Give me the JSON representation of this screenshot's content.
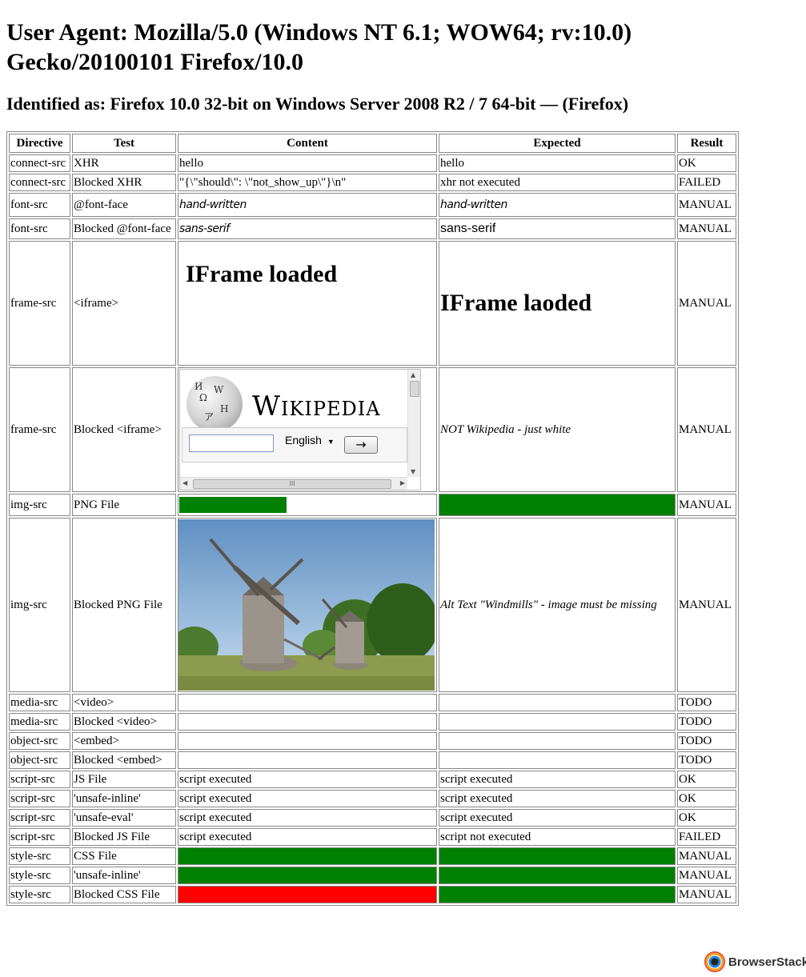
{
  "page": {
    "title": "User Agent: Mozilla/5.0 (Windows NT 6.1; WOW64; rv:10.0) Gecko/20100101 Firefox/10.0",
    "identified": "Identified as: Firefox 10.0 32-bit on Windows Server 2008 R2 / 7 64-bit — (Firefox)"
  },
  "table": {
    "headers": [
      "Directive",
      "Test",
      "Content",
      "Expected",
      "Result"
    ],
    "rows": [
      {
        "directive": "connect-src",
        "test": "XHR",
        "content": "hello",
        "expected": "hello",
        "result": "OK"
      },
      {
        "directive": "connect-src",
        "test": "Blocked XHR",
        "content": "\"{\\\"should\\\": \\\"not_show_up\\\"}\\n\"",
        "expected": "xhr not executed",
        "result": "FAILED"
      },
      {
        "directive": "font-src",
        "test": "@font-face",
        "content": "hand-written",
        "expected": "hand-written",
        "result": "MANUAL"
      },
      {
        "directive": "font-src",
        "test": "Blocked @font-face",
        "content": "sans-serif",
        "expected": "sans-serif",
        "result": "MANUAL"
      },
      {
        "directive": "frame-src",
        "test": "<iframe>",
        "content": "IFrame loaded",
        "expected": "IFrame laoded",
        "result": "MANUAL"
      },
      {
        "directive": "frame-src",
        "test": "Blocked <iframe>",
        "content": "",
        "expected": "NOT Wikipedia - just white",
        "result": "MANUAL"
      },
      {
        "directive": "img-src",
        "test": "PNG File",
        "content": "",
        "expected": "",
        "result": "MANUAL"
      },
      {
        "directive": "img-src",
        "test": "Blocked PNG File",
        "content": "",
        "expected": "Alt Text \"Windmills\" - image must be missing",
        "result": "MANUAL"
      },
      {
        "directive": "media-src",
        "test": "<video>",
        "content": "",
        "expected": "",
        "result": "TODO"
      },
      {
        "directive": "media-src",
        "test": "Blocked <video>",
        "content": "",
        "expected": "",
        "result": "TODO"
      },
      {
        "directive": "object-src",
        "test": "<embed>",
        "content": "",
        "expected": "",
        "result": "TODO"
      },
      {
        "directive": "object-src",
        "test": "Blocked <embed>",
        "content": "",
        "expected": "",
        "result": "TODO"
      },
      {
        "directive": "script-src",
        "test": "JS File",
        "content": "script executed",
        "expected": "script executed",
        "result": "OK"
      },
      {
        "directive": "script-src",
        "test": "'unsafe-inline'",
        "content": "script executed",
        "expected": "script executed",
        "result": "OK"
      },
      {
        "directive": "script-src",
        "test": "'unsafe-eval'",
        "content": "script executed",
        "expected": "script executed",
        "result": "OK"
      },
      {
        "directive": "script-src",
        "test": "Blocked JS File",
        "content": "script executed",
        "expected": "script not executed",
        "result": "FAILED"
      },
      {
        "directive": "style-src",
        "test": "CSS File",
        "content": "",
        "expected": "",
        "result": "MANUAL"
      },
      {
        "directive": "style-src",
        "test": "'unsafe-inline'",
        "content": "",
        "expected": "",
        "result": "MANUAL"
      },
      {
        "directive": "style-src",
        "test": "Blocked CSS File",
        "content": "",
        "expected": "",
        "result": "MANUAL"
      }
    ]
  },
  "wikipedia_frame": {
    "wordmark": "Wikipedia",
    "language": "English",
    "go_label": "→",
    "globe_glyphs": [
      "Ω",
      "W",
      "Н",
      "ア",
      "И"
    ],
    "scroll_thumb": "III"
  },
  "colors": {
    "pass_green": "#008000",
    "fail_red": "#ff0000"
  },
  "footer": {
    "brand": "BrowserStack"
  }
}
